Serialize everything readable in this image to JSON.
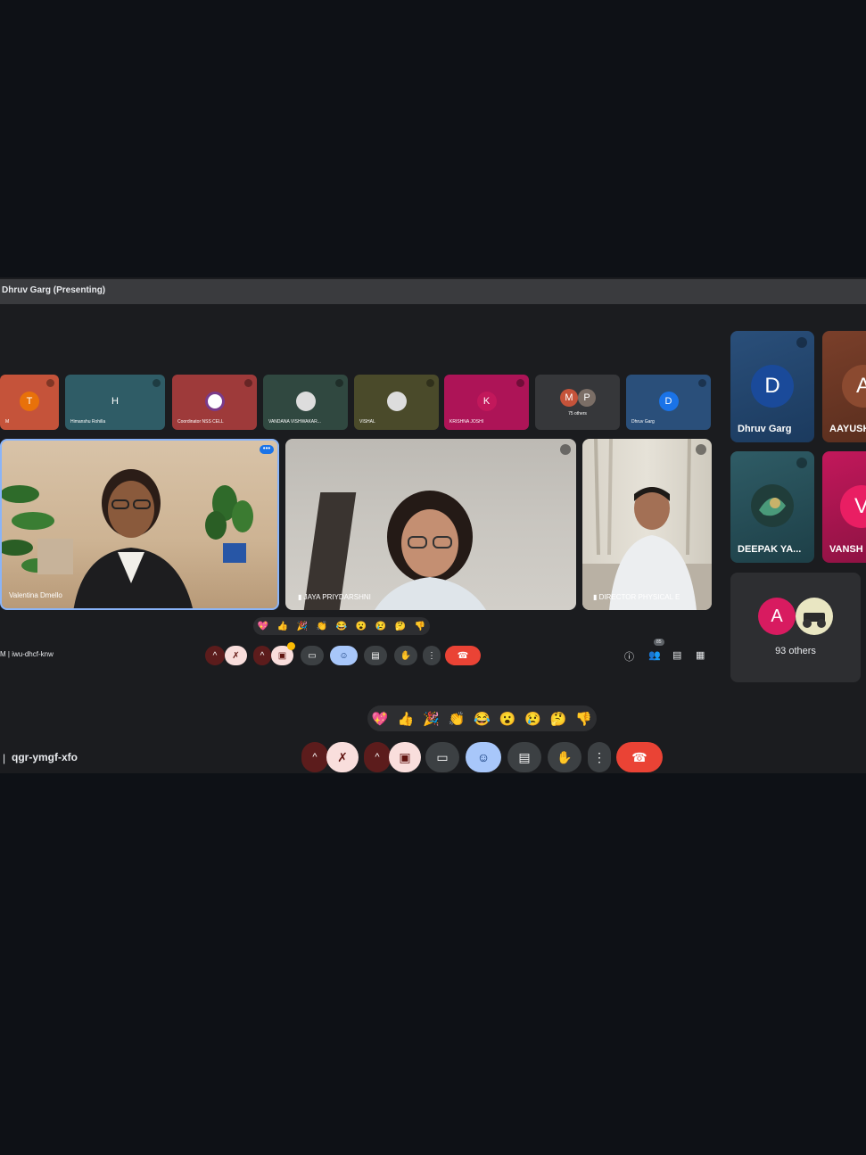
{
  "colors": {
    "background": "#0e1116",
    "surface": "#1b1c1f",
    "end_call": "#ea4335",
    "active_control": "#a8c7fa",
    "muted_control": "#f9dedc"
  },
  "shared_window": {
    "title": "Dhruv Garg (Presenting)",
    "participant_strip": [
      {
        "initial": "T",
        "name": "M",
        "color": "#e8710a",
        "bg": "#c5533a"
      },
      {
        "initial": "H",
        "name": "Himanshu Rohilla",
        "color": "#3c6a73",
        "bg": "#2f5c66"
      },
      {
        "initial": "",
        "name": "Coordinator NSS CELL",
        "color": "#b03a3a",
        "bg": "#9e3a3a"
      },
      {
        "initial": "",
        "name": "VANDANA VISHWAKAR...",
        "color": "#3c4f44",
        "bg": "#304840"
      },
      {
        "initial": "",
        "name": "VISHAL",
        "color": "#5a5a2a",
        "bg": "#4a4a2a"
      },
      {
        "initial": "K",
        "name": "KRISHNA JOSHI",
        "color": "#c2185b",
        "bg": "#ad1457"
      },
      {
        "initial": "",
        "name": "75 others",
        "color": "#3a3b3e",
        "bg": "#36373a"
      },
      {
        "initial": "D",
        "name": "Dhruv Garg",
        "color": "#1a73e8",
        "bg": "#2a4f7a"
      }
    ],
    "others_avatars": [
      "M",
      "P"
    ],
    "main_videos": [
      {
        "name": "Valentina Dmello"
      },
      {
        "name": "JAYA PRIYDARSHNI"
      },
      {
        "name": "DIRECTOR PHYSICAL E"
      }
    ],
    "emoji_bar": [
      "💖",
      "👍",
      "🎉",
      "👏",
      "😂",
      "😮",
      "😢",
      "🤔",
      "👎"
    ],
    "meeting_code": "M  |  iwu-dhcf-knw",
    "participant_count": "85"
  },
  "side_panel": {
    "tiles": [
      {
        "initial": "D",
        "label": "Dhruv Garg"
      },
      {
        "initial": "A",
        "label": "AAYUSH"
      },
      {
        "initial": "",
        "label": "DEEPAK YA..."
      },
      {
        "initial": "V",
        "label": "VANSH"
      }
    ],
    "others": {
      "initial": "A",
      "label": "93 others"
    }
  },
  "bottom_bar": {
    "emoji_bar": [
      "💖",
      "👍",
      "🎉",
      "👏",
      "😂",
      "😮",
      "😢",
      "🤔",
      "👎"
    ],
    "meeting_code": "qgr-ymgf-xfo"
  }
}
